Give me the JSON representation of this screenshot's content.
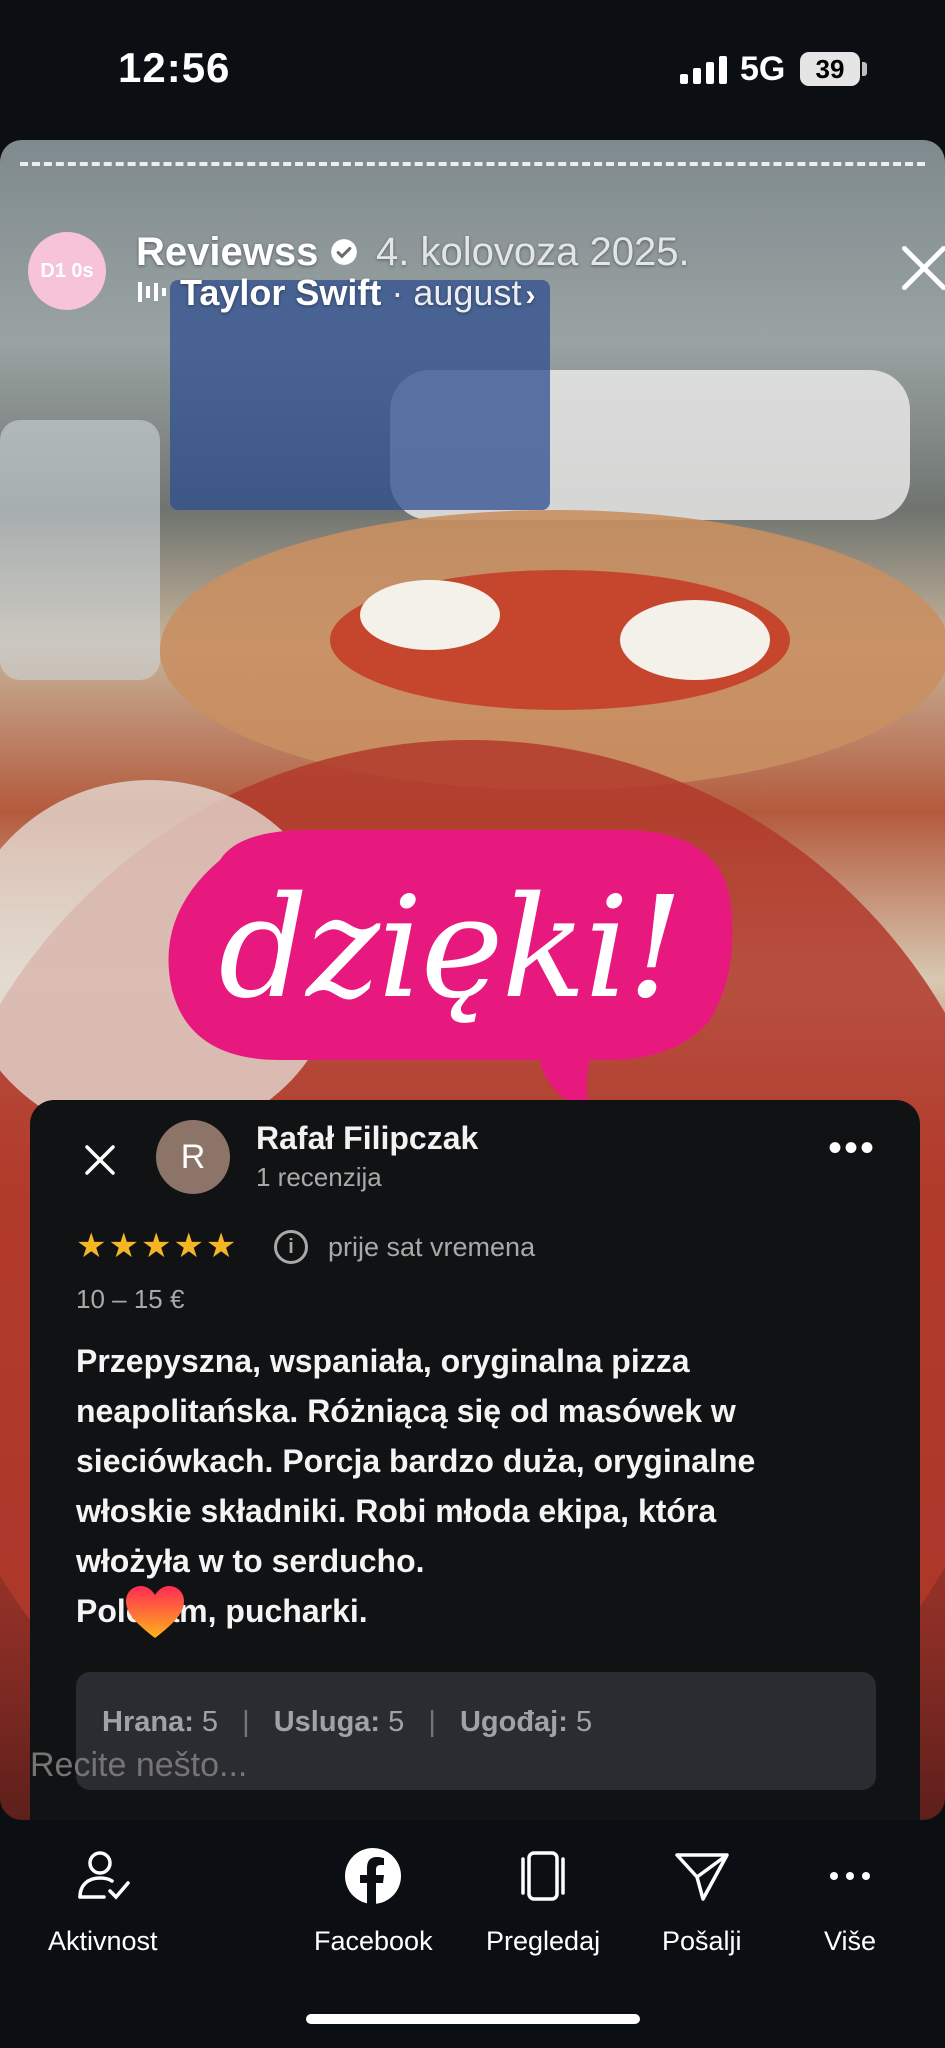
{
  "status_bar": {
    "time": "12:56",
    "network": "5G",
    "battery": "39"
  },
  "story": {
    "account_name": "Reviewss",
    "account_logo_text": "D1 0s",
    "date": "4. kolovoza 2025.",
    "song_artist": "Taylor Swift",
    "song_separator": " · ",
    "song_title": "august",
    "sticker_text": "dzięki!",
    "sticker_color": "#e8197e",
    "reply_placeholder": "Recite nešto..."
  },
  "review": {
    "reviewer_initial": "R",
    "reviewer_name": "Rafał Filipczak",
    "review_count": "1 recenzija",
    "rating": 5,
    "stars": "★★★★★",
    "time_ago": "prije sat vremena",
    "price": "10 – 15 €",
    "text": "Przepyszna, wspaniała, oryginalna pizza\nneapolitańska. Różniącą się od masówek w\nsieciówkach. Porcja bardzo duża, oryginalne\nwłoskie składniki. Robi młoda ekipa, która\nwłożyła w to serducho.\nPolecam, pucharki.",
    "ratings": [
      {
        "label": "Hrana:",
        "value": "5"
      },
      {
        "label": "Usluga:",
        "value": "5"
      },
      {
        "label": "Ugođaj:",
        "value": "5"
      }
    ]
  },
  "bottom_bar": {
    "items": [
      {
        "label": "Aktivnost",
        "icon": "activity-icon"
      },
      {
        "label": "Facebook",
        "icon": "facebook-icon"
      },
      {
        "label": "Pregledaj",
        "icon": "browse-icon"
      },
      {
        "label": "Pošalji",
        "icon": "send-icon"
      },
      {
        "label": "Više",
        "icon": "more-icon"
      }
    ]
  },
  "colors": {
    "star": "#f5b626",
    "card_bg": "#111214",
    "accent_pink": "#e8197e"
  }
}
